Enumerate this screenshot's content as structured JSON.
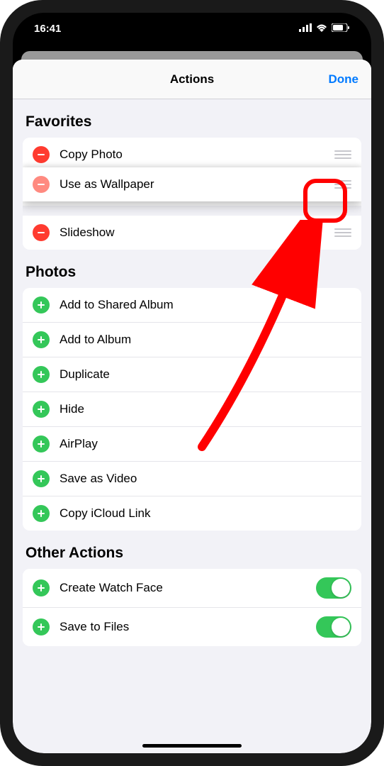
{
  "status": {
    "time": "16:41"
  },
  "header": {
    "title": "Actions",
    "done": "Done"
  },
  "sections": {
    "favorites": {
      "title": "Favorites",
      "items": [
        {
          "label": "Copy Photo"
        },
        {
          "label": "Use as Wallpaper"
        },
        {
          "label": "Slideshow"
        }
      ]
    },
    "photos": {
      "title": "Photos",
      "items": [
        {
          "label": "Add to Shared Album"
        },
        {
          "label": "Add to Album"
        },
        {
          "label": "Duplicate"
        },
        {
          "label": "Hide"
        },
        {
          "label": "AirPlay"
        },
        {
          "label": "Save as Video"
        },
        {
          "label": "Copy iCloud Link"
        }
      ]
    },
    "other": {
      "title": "Other Actions",
      "items": [
        {
          "label": "Create Watch Face",
          "toggle": true
        },
        {
          "label": "Save to Files",
          "toggle": true
        }
      ]
    }
  }
}
